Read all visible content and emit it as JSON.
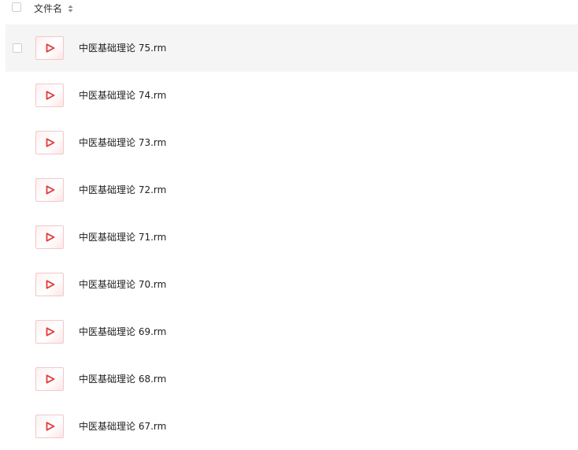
{
  "header": {
    "column_label": "文件名",
    "sort_icon": "sort-icon"
  },
  "colors": {
    "icon_accent": "#e33b3b",
    "row_hover_background": "#f5f5f5"
  },
  "files": [
    {
      "name": "中医基础理论 75.rm",
      "icon": "video-play-icon"
    },
    {
      "name": "中医基础理论 74.rm",
      "icon": "video-play-icon"
    },
    {
      "name": "中医基础理论 73.rm",
      "icon": "video-play-icon"
    },
    {
      "name": "中医基础理论 72.rm",
      "icon": "video-play-icon"
    },
    {
      "name": "中医基础理论 71.rm",
      "icon": "video-play-icon"
    },
    {
      "name": "中医基础理论 70.rm",
      "icon": "video-play-icon"
    },
    {
      "name": "中医基础理论 69.rm",
      "icon": "video-play-icon"
    },
    {
      "name": "中医基础理论 68.rm",
      "icon": "video-play-icon"
    },
    {
      "name": "中医基础理论 67.rm",
      "icon": "video-play-icon"
    }
  ]
}
